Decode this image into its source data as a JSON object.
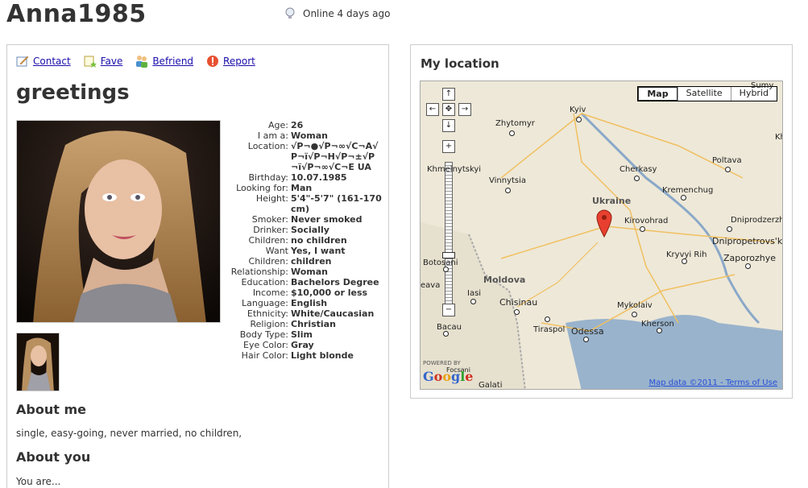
{
  "profile": {
    "username": "Anna1985",
    "online_status": "Online 4 days ago"
  },
  "actions": [
    {
      "label": "Contact",
      "icon": "pencil-paper-icon"
    },
    {
      "label": "Fave",
      "icon": "star-note-icon"
    },
    {
      "label": "Befriend",
      "icon": "people-icon"
    },
    {
      "label": "Report",
      "icon": "warning-icon"
    }
  ],
  "headline": "greetings",
  "details": [
    {
      "label": "Age:",
      "value": "26"
    },
    {
      "label": "I am a:",
      "value": "Woman"
    },
    {
      "label": "Location:",
      "value": "√Р¬●√Р¬∞√С¬А√Р¬ї√Р¬Н√Р¬±√Р¬ї√Р¬∞√С¬Е UA"
    },
    {
      "label": "Birthday:",
      "value": "10.07.1985"
    },
    {
      "label": "Looking for:",
      "value": "Man"
    },
    {
      "label": "Height:",
      "value": "5'4\"-5'7\" (161-170cm)"
    },
    {
      "label": "Smoker:",
      "value": "Never smoked"
    },
    {
      "label": "Drinker:",
      "value": "Socially"
    },
    {
      "label": "Children:",
      "value": "no children"
    },
    {
      "label": "Want",
      "value": "Yes, I want"
    },
    {
      "label": "Children:",
      "value": "children"
    },
    {
      "label": "Relationship:",
      "value": "Woman"
    },
    {
      "label": "Education:",
      "value": "Bachelors Degree"
    },
    {
      "label": "Income:",
      "value": "$10,000 or less"
    },
    {
      "label": "Language:",
      "value": "English"
    },
    {
      "label": "Ethnicity:",
      "value": "White/Caucasian"
    },
    {
      "label": "Religion:",
      "value": "Christian"
    },
    {
      "label": "Body Type:",
      "value": "Slim"
    },
    {
      "label": "Eye Color:",
      "value": "Gray"
    },
    {
      "label": "Hair Color:",
      "value": "Light blonde"
    }
  ],
  "about_me": {
    "title": "About me",
    "text": "single, easy-going, never married, no children,"
  },
  "about_you": {
    "title": "About you",
    "text": "You are..."
  },
  "location": {
    "title": "My location",
    "map_types": [
      "Map",
      "Satellite",
      "Hybrid"
    ],
    "selected_map_type": "Map",
    "country_labels": [
      "Ukraine",
      "Moldova"
    ],
    "cities": [
      "Kyiv",
      "Zhytomyr",
      "Khmelnytskyi",
      "Vinnytsia",
      "Cherkasy",
      "Poltava",
      "Kremenchug",
      "Kirovohrad",
      "Dniprodzerzhy",
      "Dnipropetrovs'k",
      "Kryvyi Rih",
      "Zaporozhye",
      "Chisinau",
      "Tiraspol",
      "Odessa",
      "Mykolaiv",
      "Kherson",
      "Botosani",
      "Iasi",
      "Bacau",
      "Galati",
      "Sumy",
      "Kh",
      "eava",
      "Focsani"
    ],
    "footer_data": "Map data ©2011",
    "footer_terms": "Terms of Use",
    "powered_by": "POWERED BY",
    "google": "Google"
  }
}
